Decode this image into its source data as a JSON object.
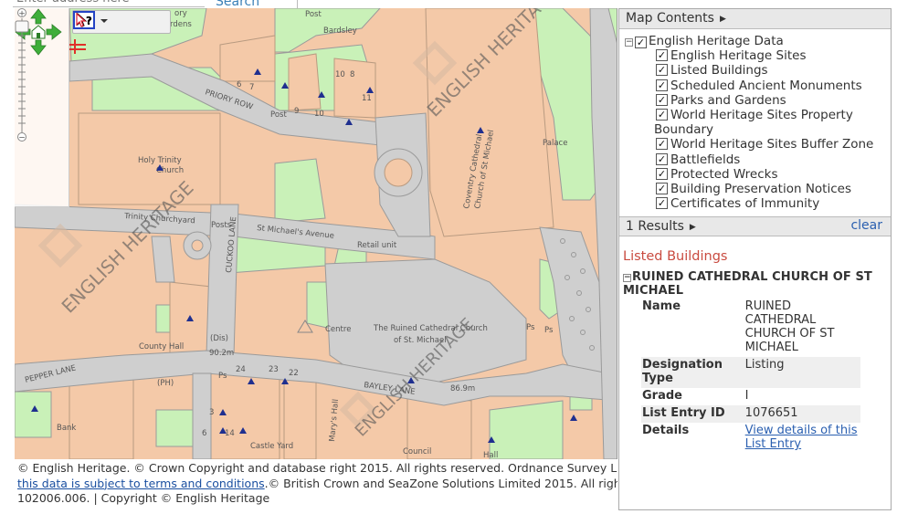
{
  "search": {
    "placeholder": "Enter address here",
    "button_label": "Search"
  },
  "map": {
    "watermark": "ENGLISH HERITAGE",
    "labels": {
      "post1": "Post",
      "bardsley": "Bardsley",
      "post2": "Post",
      "posts": "Posts",
      "priory_row": "PRIORY ROW",
      "holy_trinity_1": "Holy Trinity",
      "holy_trinity_2": "Church",
      "trinity_churchyard": "Trinity Churchyard",
      "st_michaels_ave": "St Michael's Avenue",
      "retail_unit": "Retail unit",
      "cathedral_1": "Coventry Cathedral",
      "cathedral_2": "Church of St Michael",
      "palace": "Palace",
      "cuckoo_lane": "CUCKOO LANE",
      "centre": "Centre",
      "ruined_1": "The Ruined Cathedral Church",
      "ruined_2": "of St. Michael",
      "ps1": "Ps",
      "ps2": "Ps",
      "ps3": "Ps",
      "county_hall": "County Hall",
      "dis": "(Dis)",
      "level1": "90.2m",
      "level2": "86.9m",
      "pepper_lane": "PEPPER LANE",
      "ph": "(PH)",
      "bayley_lane": "BAYLEY LANE",
      "bank": "Bank",
      "castle_yard": "Castle Yard",
      "marys_hall": "Mary's Hall",
      "council": "Council",
      "hall": "Hall",
      "ory": "ory",
      "rdens": "rdens",
      "n6": "6",
      "n7": "7",
      "n9": "9",
      "n10": "10",
      "n11": "11",
      "n10b": "10",
      "n8": "8",
      "n24": "24",
      "n23": "23",
      "n22": "22",
      "n3": "3",
      "n6b": "6",
      "n14": "14"
    }
  },
  "toolbar": {
    "globe_icon": "globe-icon",
    "identify_icon": "identify-cursor-icon",
    "query_icon": "query-dropdown-icon"
  },
  "navigation": {
    "pan_icon": "pan-arrows-icon",
    "zoom_in": "+",
    "zoom_out": "−"
  },
  "attribution": {
    "line1": "© English Heritage. © Crown Copyright and database right 2015. All rights reserved. Ordnance Survey Licence number",
    "link": "this data is subject to terms and conditions",
    "line2_rest": ".© British Crown and SeaZone Solutions Limited 2015. All rights reserved. Licence number",
    "line3": "102006.006. | Copyright © English Heritage"
  },
  "map_contents": {
    "header": "Map Contents",
    "root_label": "English Heritage Data",
    "layers": [
      {
        "label": "English Heritage Sites",
        "checked": "✓"
      },
      {
        "label": "Listed Buildings",
        "checked": "✓"
      },
      {
        "label": "Scheduled Ancient Monuments",
        "checked": "✓"
      },
      {
        "label": "Parks and Gardens",
        "checked": "✓"
      },
      {
        "label": "World Heritage Sites Property",
        "label2": "Boundary",
        "checked": "✓"
      },
      {
        "label": "World Heritage Sites Buffer Zone",
        "checked": "✓"
      },
      {
        "label": "Battlefields",
        "checked": "✓"
      },
      {
        "label": "Protected Wrecks",
        "checked": "✓"
      },
      {
        "label": "Building Preservation Notices",
        "checked": "✓"
      },
      {
        "label": "Certificates of Immunity",
        "checked": "✓"
      }
    ],
    "root_checked": "✓",
    "expander": "−"
  },
  "results": {
    "header": "1 Results",
    "clear_label": "clear",
    "category": "Listed Buildings",
    "title": "RUINED CATHEDRAL CHURCH OF ST MICHAEL",
    "attributes": [
      {
        "key": "Name",
        "value": "RUINED CATHEDRAL CHURCH OF ST MICHAEL"
      },
      {
        "key": "Designation Type",
        "value": "Listing"
      },
      {
        "key": "Grade",
        "value": "I"
      },
      {
        "key": "List Entry ID",
        "value": "1076651"
      },
      {
        "key": "Details",
        "value": "View details of this List Entry"
      }
    ]
  },
  "colors": {
    "building": "#f4c9a8",
    "green": "#c9f1b8",
    "road": "#cfcfcf",
    "road_edge": "#9a9a9a",
    "marker": "#1f2f8f",
    "category": "#c94b40",
    "link": "#2a5fb0"
  }
}
